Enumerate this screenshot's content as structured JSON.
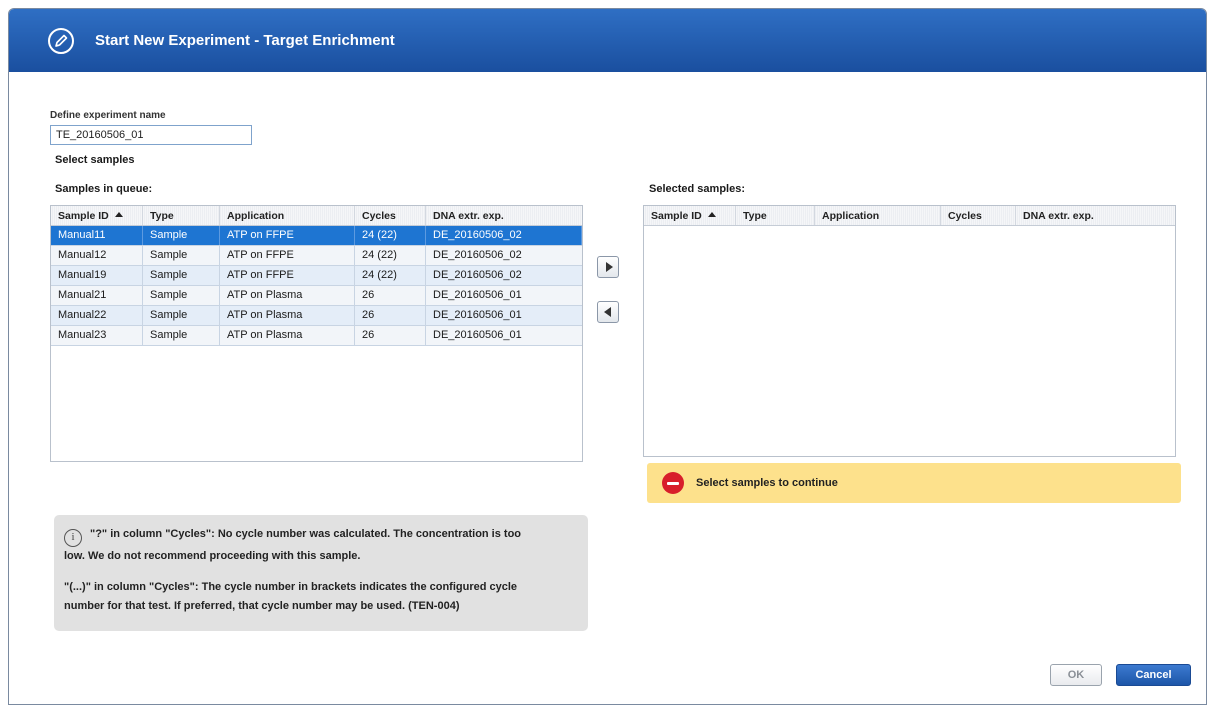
{
  "dialog": {
    "title": "Start New Experiment - Target Enrichment",
    "icon": "pencil-circle-icon"
  },
  "experiment_name": {
    "label": "Define experiment name",
    "value": "TE_20160506_01"
  },
  "select_samples_label": "Select samples",
  "queue": {
    "label": "Samples in queue:",
    "columns": [
      "Sample ID",
      "Type",
      "Application",
      "Cycles",
      "DNA extr. exp."
    ],
    "sort_column": "Sample ID",
    "rows": [
      {
        "id": "Manual11",
        "type": "Sample",
        "application": "ATP on FFPE",
        "cycles": "24 (22)",
        "dna": "DE_20160506_02",
        "selected": true
      },
      {
        "id": "Manual12",
        "type": "Sample",
        "application": "ATP on FFPE",
        "cycles": "24 (22)",
        "dna": "DE_20160506_02",
        "selected": false
      },
      {
        "id": "Manual19",
        "type": "Sample",
        "application": "ATP on FFPE",
        "cycles": "24 (22)",
        "dna": "DE_20160506_02",
        "selected": false
      },
      {
        "id": "Manual21",
        "type": "Sample",
        "application": "ATP on Plasma",
        "cycles": "26",
        "dna": "DE_20160506_01",
        "selected": false
      },
      {
        "id": "Manual22",
        "type": "Sample",
        "application": "ATP on Plasma",
        "cycles": "26",
        "dna": "DE_20160506_01",
        "selected": false
      },
      {
        "id": "Manual23",
        "type": "Sample",
        "application": "ATP on Plasma",
        "cycles": "26",
        "dna": "DE_20160506_01",
        "selected": false
      }
    ]
  },
  "selected": {
    "label": "Selected samples:",
    "columns": [
      "Sample ID",
      "Type",
      "Application",
      "Cycles",
      "DNA extr. exp."
    ],
    "rows": []
  },
  "transfer": {
    "add_icon": "arrow-right-icon",
    "remove_icon": "arrow-left-icon"
  },
  "warning": {
    "icon": "stop-icon",
    "text": "Select samples to continue",
    "color": "#fde18c"
  },
  "info": {
    "icon": "info-icon",
    "line1a": "\"?\" in column \"Cycles\": No cycle number was calculated. The concentration is too",
    "line1b": "low. We do not recommend proceeding with this sample.",
    "line2a": "\"(...)\" in column \"Cycles\": The cycle number in brackets indicates the configured cycle",
    "line2b": "number for that test. If preferred, that cycle number may be used. (TEN-004)"
  },
  "buttons": {
    "ok": "OK",
    "cancel": "Cancel"
  },
  "colors": {
    "titlebar": "#1a4f9f",
    "selection": "#1e75d2",
    "accent": "#1d56a8"
  }
}
